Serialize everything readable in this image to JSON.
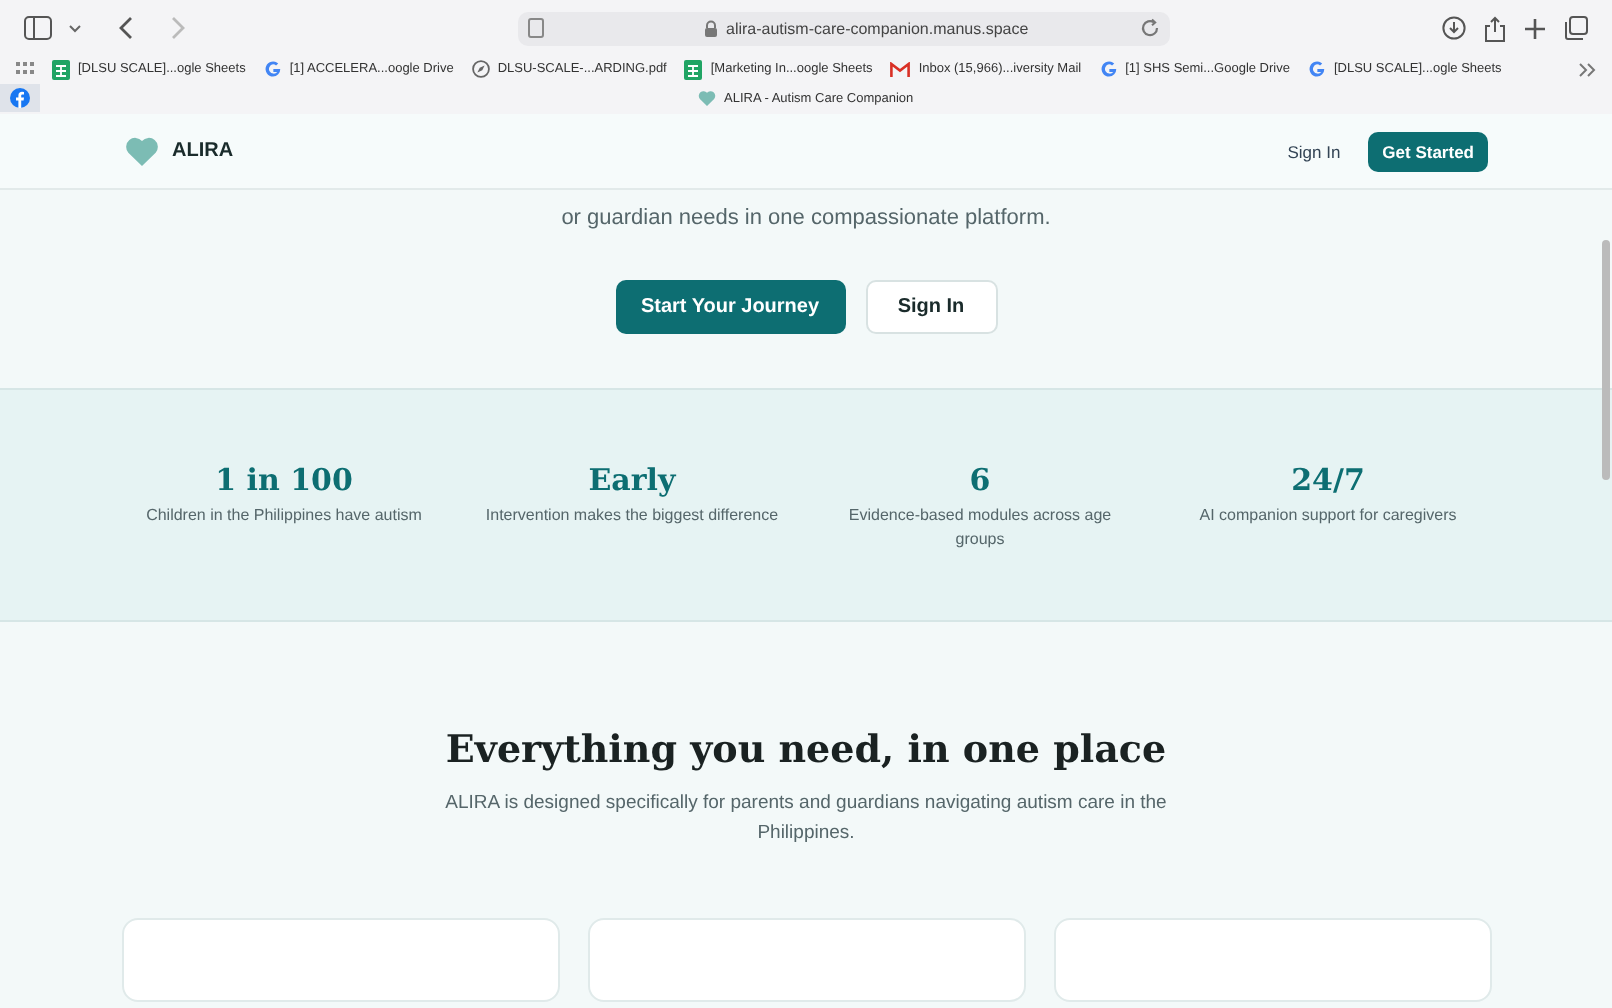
{
  "browser": {
    "url": "alira-autism-care-companion.manus.space",
    "bookmarks": [
      {
        "label": "[DLSU SCALE]...ogle Sheets",
        "kind": "sheets"
      },
      {
        "label": "[1] ACCELERA...oogle Drive",
        "kind": "google"
      },
      {
        "label": "DLSU-SCALE-...ARDING.pdf",
        "kind": "pdf"
      },
      {
        "label": "[Marketing In...oogle Sheets",
        "kind": "sheets"
      },
      {
        "label": "Inbox (15,966)...iversity Mail",
        "kind": "mail"
      },
      {
        "label": "[1] SHS Semi...Google Drive",
        "kind": "google"
      },
      {
        "label": "[DLSU SCALE]...ogle Sheets",
        "kind": "google"
      }
    ],
    "tab": {
      "title": "ALIRA - Autism Care Companion"
    }
  },
  "header": {
    "brand": "ALIRA",
    "sign_in": "Sign In",
    "get_started": "Get Started"
  },
  "hero": {
    "lines": [
      "or guardian needs in one compassionate platform."
    ],
    "primary": "Start Your Journey",
    "secondary": "Sign In"
  },
  "stats": [
    {
      "value": "1 in 100",
      "label": "Children in the Philippines have autism"
    },
    {
      "value": "Early",
      "label": "Intervention makes the biggest difference"
    },
    {
      "value": "6",
      "label": "Evidence-based modules across age groups"
    },
    {
      "value": "24/7",
      "label": "AI companion support for caregivers"
    }
  ],
  "features": {
    "title": "Everything you need, in one place",
    "subtitle": "ALIRA is designed specifically for parents and guardians navigating autism care in the Philippines.",
    "cards": [
      {
        "kind": "card"
      },
      {
        "kind": "card"
      },
      {
        "kind": "card"
      }
    ]
  }
}
